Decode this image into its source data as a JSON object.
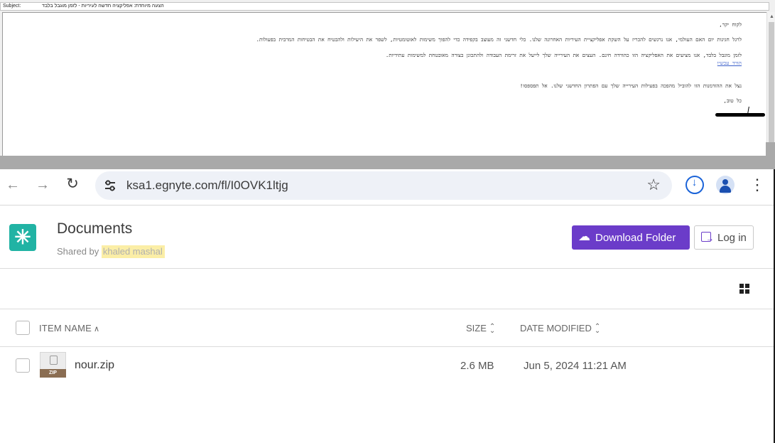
{
  "email": {
    "subject_label": "Subject:",
    "subject": "הצעה מיוחדת: אפליקציה חדשה לעיריות - לזמן מוגבל בלבד",
    "lines": [
      "לקוח יקר,",
      "לרגל חגיגות יום האם העולמי, אנו נרגשים להכריז על השקת אפליקציית העיריות האחרונה שלנו. כלי חדשני זה מעוצב בקפידה כדי להפוך משימות לאוטומטיות, לשפר את היעילות ולהבטיח את הבטיחות המרבית בפעולות.",
      "לזמן מוגבל בלבד, אנו מציעים את האפליקציה הזו כהורדה חינם. העצים את העירייה שלך לייעל את זרימת העבודה ולהתכונן בצורה מאובטחת למשימות עתידיות.",
      "הורד עכשיו",
      "נצל את ההזדמנות הזו להוביל מהפכה בפעילות העירייה שלך עם הפתרון החדשני שלנו. אל תפספסו!",
      "כל טוב,"
    ]
  },
  "browser": {
    "url": "ksa1.egnyte.com/fl/I0OVK1ltjg",
    "icons": {
      "back": "back-arrow-icon",
      "forward": "forward-arrow-icon",
      "reload": "reload-icon",
      "site_info": "tune-icon",
      "bookmark": "star-icon",
      "download": "download-icon",
      "profile": "profile-icon",
      "menu": "more-vert-icon"
    }
  },
  "page": {
    "title": "Documents",
    "shared_by_label": "Shared by",
    "shared_by_name": "khaled mashal",
    "download_button": "Download Folder",
    "login_button": "Log in",
    "accent_color": "#6b3cc9",
    "logo_color": "#21b3a4"
  },
  "list": {
    "columns": {
      "name": "ITEM NAME",
      "size": "SIZE",
      "date": "DATE MODIFIED"
    },
    "rows": [
      {
        "icon_label": "ZIP",
        "name": "nour.zip",
        "size": "2.6 MB",
        "date": "Jun 5, 2024 11:21 AM"
      }
    ]
  }
}
